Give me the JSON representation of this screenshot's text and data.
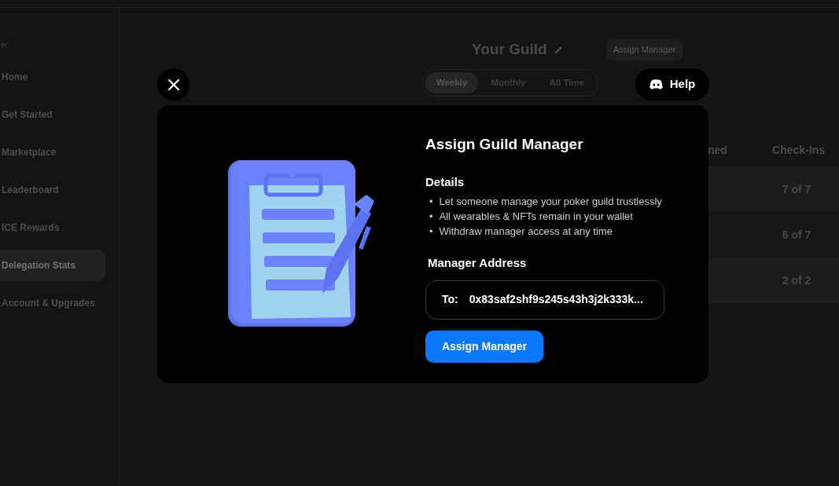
{
  "sidebar": {
    "heading": "er",
    "items": [
      {
        "label": "Home",
        "selected": false
      },
      {
        "label": "Get Started",
        "selected": false
      },
      {
        "label": "Marketplace",
        "selected": false
      },
      {
        "label": "Leaderboard",
        "selected": false
      },
      {
        "label": "ICE Rewards",
        "selected": false
      },
      {
        "label": "Delegation Stats",
        "selected": true
      },
      {
        "label": "Account & Upgrades",
        "selected": false
      }
    ]
  },
  "guild": {
    "title": "Your Guild",
    "assign_button": "Assign Manager",
    "periods": [
      {
        "label": "Weekly",
        "selected": true
      },
      {
        "label": "Monthly",
        "selected": false
      },
      {
        "label": "All Time",
        "selected": false
      }
    ]
  },
  "table": {
    "columns": [
      "ned",
      "Check-Ins"
    ],
    "rows": [
      {
        "check_ins": "7 of 7"
      },
      {
        "check_ins": "6 of 7"
      },
      {
        "check_ins": "2 of 2"
      }
    ]
  },
  "help_button": "Help",
  "modal": {
    "title": "Assign Guild Manager",
    "details_heading": "Details",
    "details": [
      {
        "bullet": "•",
        "text": "Let someone manage your poker guild trustlessly"
      },
      {
        "bullet": "•",
        "text": "All wearables & NFTs remain in your wallet"
      },
      {
        "bullet": "•",
        "text": "Withdraw manager access at any time"
      }
    ],
    "address_label": "Manager Address",
    "address_prefix": "To:",
    "address_value": "0x83saf2shf9s245s43h3j2k333k...",
    "submit_button": "Assign Manager"
  }
}
